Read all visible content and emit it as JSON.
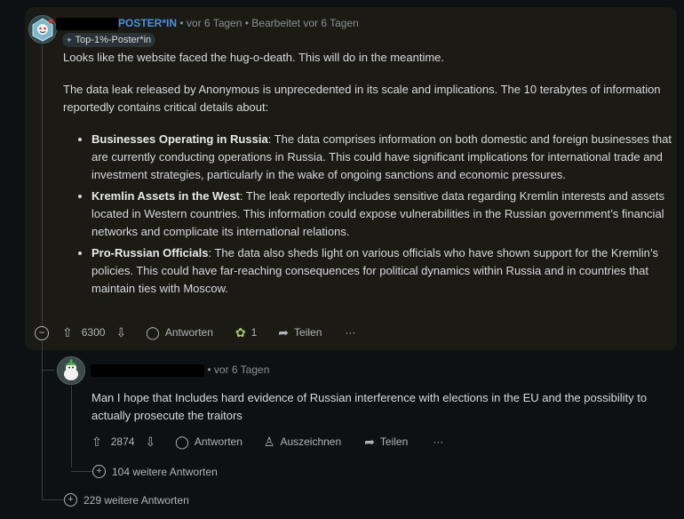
{
  "top_comment": {
    "username_visible": "POSTER*IN",
    "timestamp": "vor 6 Tagen",
    "edited": "Bearbeitet vor 6 Tagen",
    "flair": "Top-1%-Poster*in",
    "intro": "Looks like the website faced the hug-o-death. This will do in the meantime.",
    "paragraph": "The data leak released by Anonymous is unprecedented in its scale and implications. The 10 terabytes of information reportedly contains critical details about:",
    "points": [
      {
        "title": "Businesses Operating in Russia",
        "text": ": The data comprises information on both domestic and foreign businesses that are currently conducting operations in Russia. This could have significant implications for international trade and investment strategies, particularly in the wake of ongoing sanctions and economic pressures."
      },
      {
        "title": "Kremlin Assets in the West",
        "text": ": The leak reportedly includes sensitive data regarding Kremlin interests and assets located in Western countries. This information could expose vulnerabilities in the Russian government’s financial networks and complicate its international relations."
      },
      {
        "title": "Pro-Russian Officials",
        "text": ": The data also sheds light on various officials who have shown support for the Kremlin’s policies. This could have far-reaching consequences for political dynamics within Russia and in countries that maintain ties with Moscow."
      }
    ],
    "votes": "6300",
    "reply_label": "Antworten",
    "award_count": "1",
    "share_label": "Teilen",
    "more_label": "···"
  },
  "reply": {
    "timestamp": "vor 6 Tagen",
    "text": "Man I hope that Includes hard evidence of Russian interference with elections in the EU and the possibility to actually prosecute the traitors",
    "votes": "2874",
    "reply_label": "Antworten",
    "award_label": "Auszeichnen",
    "share_label": "Teilen",
    "more_label": "···",
    "more_replies": "104 weitere Antworten"
  },
  "more_replies_top": "229 weitere Antworten",
  "colors": {
    "card_bg": "#1b1a15",
    "page_bg": "#0e1113",
    "username": "#4a90e2"
  }
}
